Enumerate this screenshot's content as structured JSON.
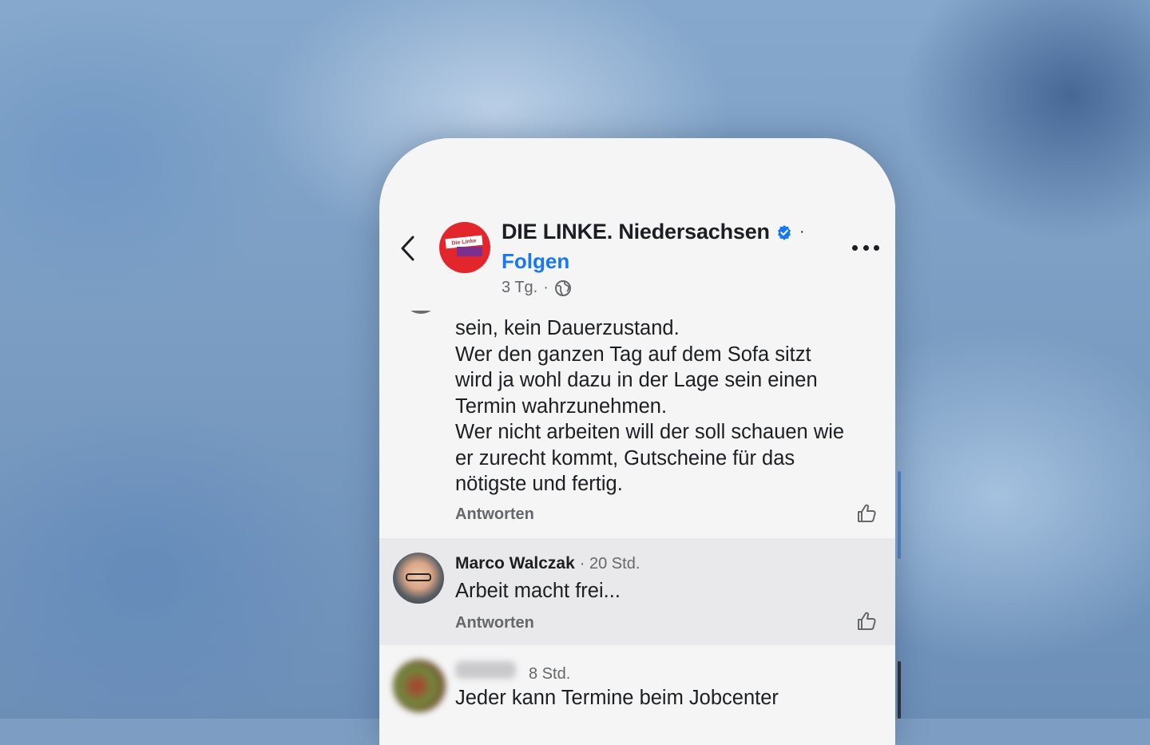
{
  "page": {
    "name": "DIE LINKE. Niedersachsen",
    "separator": "·",
    "follow_label": "Folgen",
    "post_age": "3 Tg.",
    "meta_separator": "·",
    "logo_text": "Die Linke",
    "icons": {
      "back": "chevron-left-icon",
      "verified": "verified-badge-icon",
      "privacy": "globe-icon",
      "more": "more-icon"
    }
  },
  "colors": {
    "link": "#1877f2",
    "party_red": "#e3262b",
    "party_purple": "#7b2f8e",
    "secondary_text": "#65676b"
  },
  "comments": [
    {
      "lines": [
        "sein, kein Dauerzustand.",
        "Wer den ganzen Tag auf dem Sofa sitzt",
        "wird ja wohl dazu in der Lage sein einen",
        "Termin wahrzunehmen.",
        "Wer nicht arbeiten will der soll schauen wie",
        "er zurecht kommt, Gutscheine für das",
        "nötigste und fertig."
      ],
      "reply_label": "Antworten"
    },
    {
      "author": "Marco Walczak",
      "time": "· 20 Std.",
      "lines": [
        "Arbeit macht frei..."
      ],
      "reply_label": "Antworten"
    },
    {
      "time": "8 Std.",
      "lines": [
        "Jeder kann Termine beim Jobcenter"
      ]
    }
  ]
}
